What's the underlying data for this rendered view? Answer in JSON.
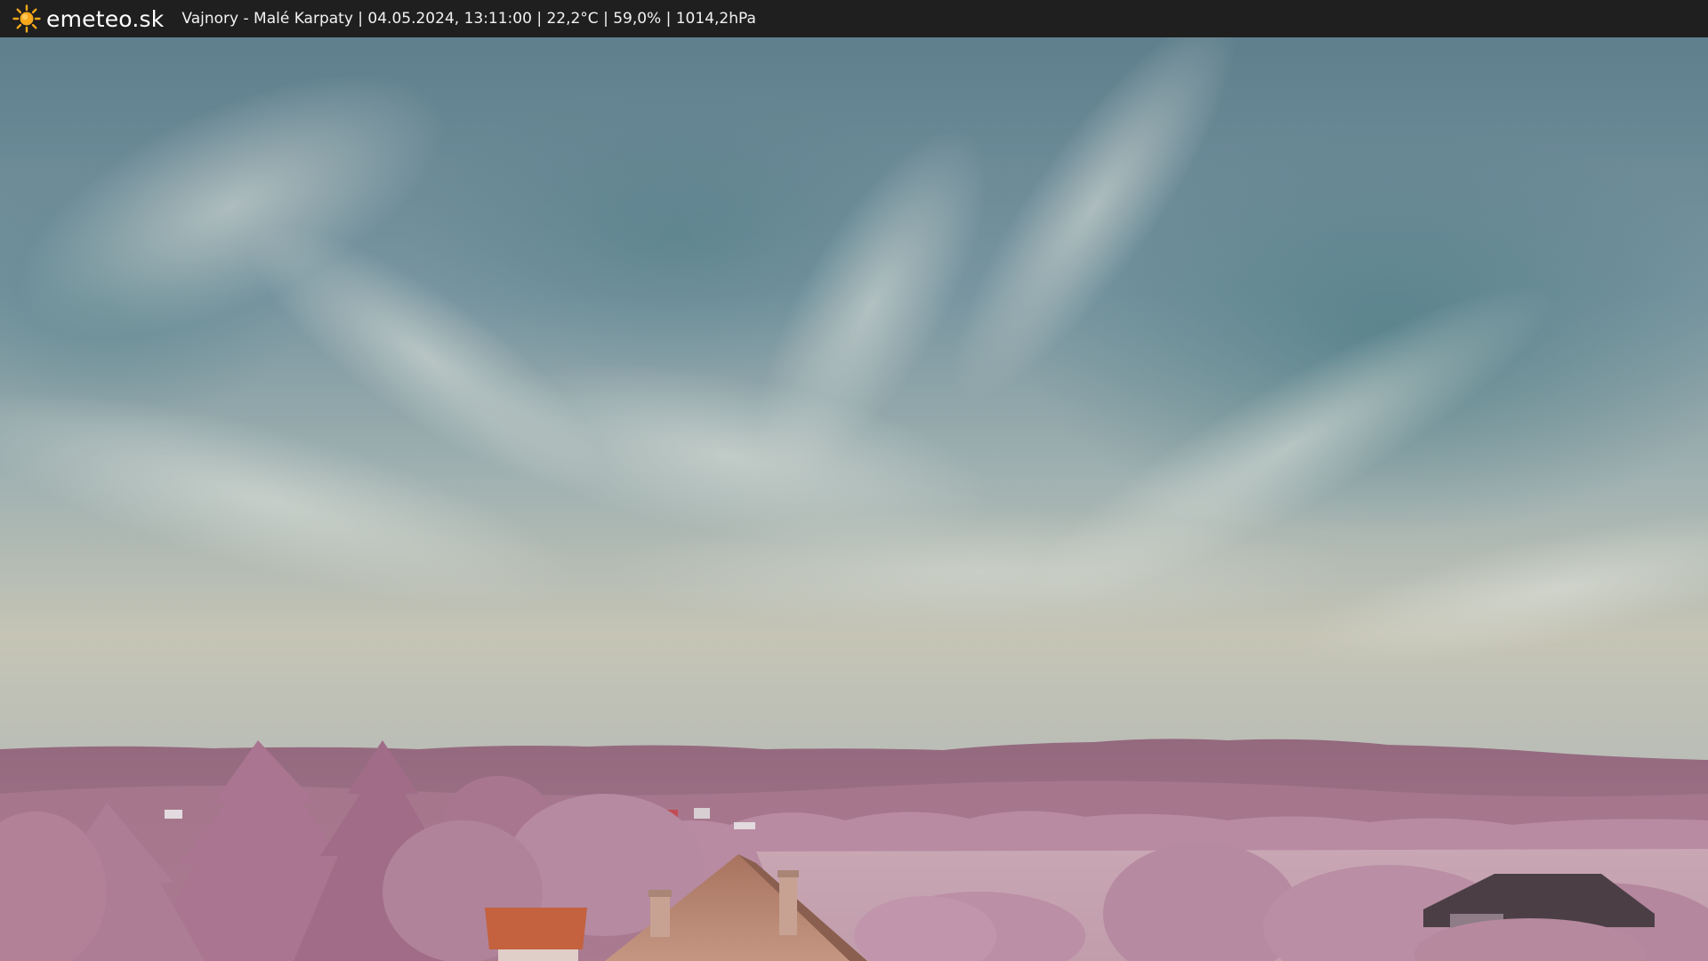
{
  "header": {
    "brand": "emeteo.sk",
    "logo_icon": "sun-icon",
    "caption": "Vajnory - Malé Karpaty | 04.05.2024, 13:11:00 | 22,2°C | 59,0% | 1014,2hPa"
  },
  "colors": {
    "bar": "#1f1f1f",
    "sun": "#f7a81b",
    "sky_top": "#5e7e8c",
    "sky_horizon": "#c9c6b6",
    "hills": "#9b6d84",
    "foliage": "#b98aa3",
    "roof_tile": "#c4613e",
    "field": "#c9aab6"
  }
}
